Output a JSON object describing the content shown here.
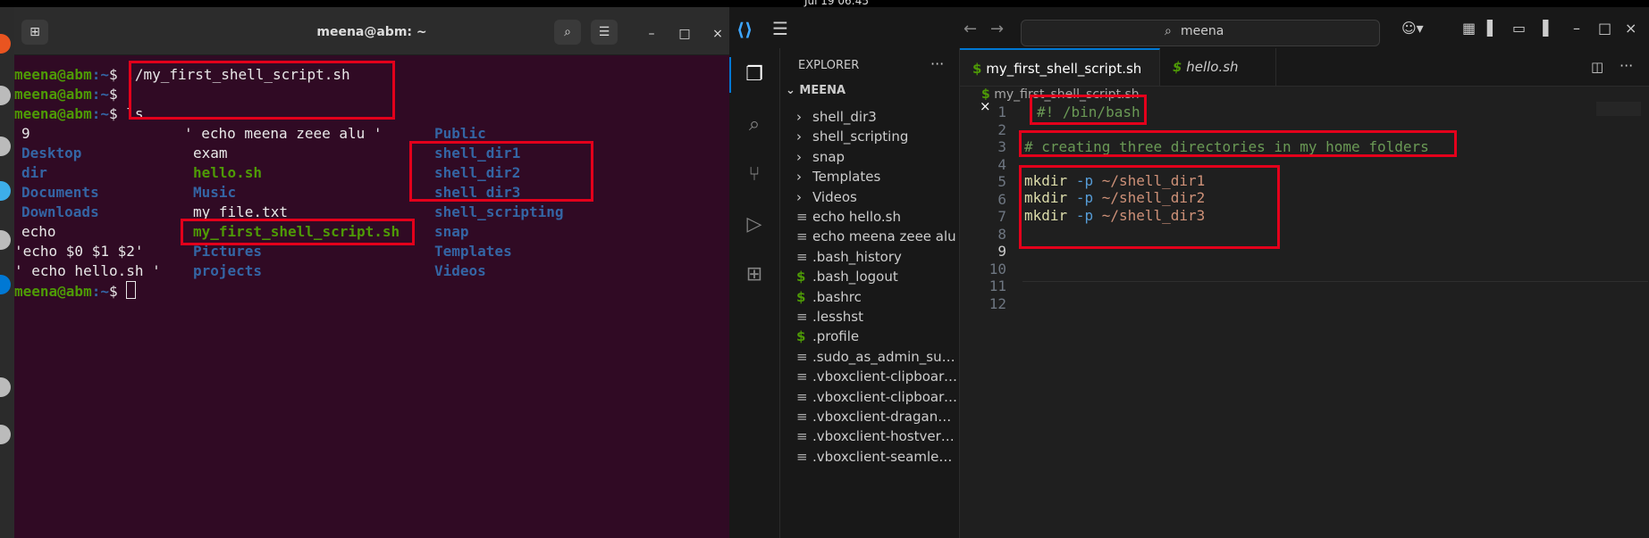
{
  "system": {
    "clock": "Jul 19  06:45"
  },
  "terminal": {
    "title": "meena@abm: ~",
    "prompt_user": "meena@abm",
    "prompt_path": ":~",
    "prompt_dollar": "$ ",
    "cmd1": "./my_first_shell_script.sh",
    "cmd3": "ls",
    "ls": {
      "col1": [
        "9",
        "Desktop",
        "dir",
        "Documents",
        "Downloads",
        "echo",
        "'echo $0 $1 $2'",
        "' echo hello.sh '"
      ],
      "col2": [
        "' echo meena zeee alu '",
        "exam",
        "hello.sh",
        "Music",
        "my_file.txt",
        "my_first_shell_script.sh",
        "Pictures",
        "projects"
      ],
      "col3": [
        "Public",
        "shell_dir1",
        "shell_dir2",
        "shell_dir3",
        "shell_scripting",
        "snap",
        "Templates",
        "Videos"
      ]
    }
  },
  "vscode": {
    "search_value": "meena",
    "explorer_title": "EXPLORER",
    "explorer_more": "···",
    "workspace": "MEENA",
    "files": [
      {
        "icon": "chevron",
        "name": "shell_dir3"
      },
      {
        "icon": "chevron",
        "name": "shell_scripting"
      },
      {
        "icon": "chevron",
        "name": "snap"
      },
      {
        "icon": "chevron",
        "name": "Templates"
      },
      {
        "icon": "chevron",
        "name": "Videos"
      },
      {
        "icon": "lines",
        "name": "echo hello.sh"
      },
      {
        "icon": "lines",
        "name": "echo meena zeee alu"
      },
      {
        "icon": "lines",
        "name": ".bash_history"
      },
      {
        "icon": "dollar",
        "name": ".bash_logout"
      },
      {
        "icon": "dollar",
        "name": ".bashrc"
      },
      {
        "icon": "lines",
        "name": ".lesshst"
      },
      {
        "icon": "dollar",
        "name": ".profile"
      },
      {
        "icon": "lines",
        "name": ".sudo_as_admin_suc..."
      },
      {
        "icon": "lines",
        "name": ".vboxclient-clipboard..."
      },
      {
        "icon": "lines",
        "name": ".vboxclient-clipboard..."
      },
      {
        "icon": "lines",
        "name": ".vboxclient-dragand..."
      },
      {
        "icon": "lines",
        "name": ".vboxclient-hostversi..."
      },
      {
        "icon": "lines",
        "name": ".vboxclient-seamless..."
      }
    ],
    "tabs": [
      {
        "label": "my_first_shell_script.sh",
        "close": "×"
      },
      {
        "label": "hello.sh"
      }
    ],
    "breadcrumb": "my_first_shell_script.sh",
    "line_numbers": [
      "1",
      "2",
      "3",
      "4",
      "5",
      "6",
      "7",
      "8",
      "9",
      "10",
      "11",
      "12"
    ],
    "code": {
      "l1": "#! /bin/bash",
      "l3": "# creating three directories in my home folders",
      "mkdir": "mkdir",
      "opt": "-p",
      "d1": "~/shell_dir1",
      "d2": "~/shell_dir2",
      "d3": "~/shell_dir3"
    }
  }
}
